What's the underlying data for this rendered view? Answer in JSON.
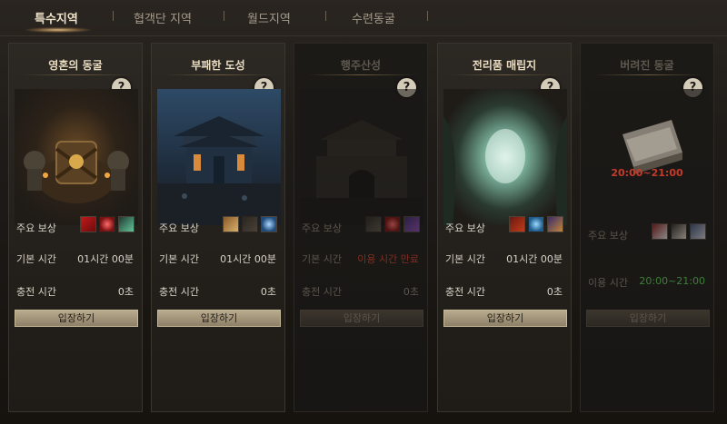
{
  "tabs": [
    {
      "label": "특수지역",
      "active": true
    },
    {
      "label": "협객단 지역",
      "active": false
    },
    {
      "label": "월드지역",
      "active": false
    },
    {
      "label": "수련동굴",
      "active": false
    }
  ],
  "cards": [
    {
      "title": "영혼의 동굴",
      "help": "?",
      "reward_label": "주요 보상",
      "base_time_label": "기본 시간",
      "base_time": "01시간 00분",
      "charge_label": "충전 시간",
      "charge_value": "0초",
      "button": "입장하기",
      "enabled": true
    },
    {
      "title": "부패한 도성",
      "help": "?",
      "reward_label": "주요 보상",
      "base_time_label": "기본 시간",
      "base_time": "01시간 00분",
      "charge_label": "충전 시간",
      "charge_value": "0초",
      "button": "입장하기",
      "enabled": true
    },
    {
      "title": "행주산성",
      "help": "?",
      "reward_label": "주요 보상",
      "base_time_label": "기본 시간",
      "base_time": "이용 시간 만료",
      "charge_label": "충전 시간",
      "charge_value": "0초",
      "button": "입장하기",
      "enabled": false
    },
    {
      "title": "전리품 매립지",
      "help": "?",
      "reward_label": "주요 보상",
      "base_time_label": "기본 시간",
      "base_time": "01시간 00분",
      "charge_label": "충전 시간",
      "charge_value": "0초",
      "button": "입장하기",
      "enabled": true
    },
    {
      "title": "버려진 동굴",
      "help": "?",
      "schedule": "20:00~21:00",
      "reward_label": "주요 보상",
      "use_time_label": "이용 시간",
      "use_time": "20:00~21:00",
      "button": "입장하기",
      "enabled": false
    }
  ]
}
